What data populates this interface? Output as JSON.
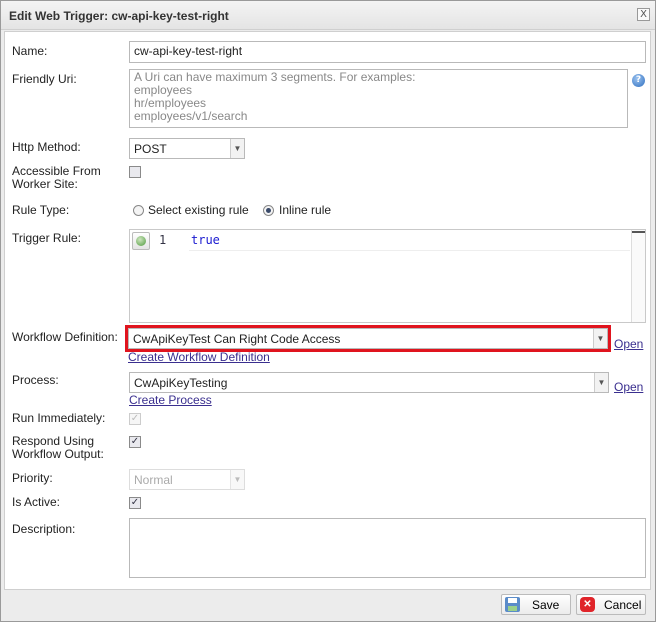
{
  "dialog": {
    "title": "Edit Web Trigger: cw-api-key-test-right",
    "close_label": "X"
  },
  "fields": {
    "name": {
      "label": "Name:",
      "value": "cw-api-key-test-right"
    },
    "friendly_uri": {
      "label": "Friendly Uri:",
      "placeholder_lines": [
        "A Uri can have maximum 3 segments. For examples:",
        "employees",
        "hr/employees",
        "employees/v1/search"
      ]
    },
    "http_method": {
      "label": "Http Method:",
      "value": "POST"
    },
    "accessible": {
      "label_lines": [
        "Accessible From",
        "Worker Site:"
      ],
      "checked": false
    },
    "rule_type": {
      "label": "Rule Type:",
      "options": [
        "Select existing rule",
        "Inline rule"
      ],
      "selected": "Inline rule"
    },
    "trigger_rule": {
      "label": "Trigger Rule:",
      "line_number": "1",
      "code": "true"
    },
    "workflow_definition": {
      "label": "Workflow Definition:",
      "value": "CwApiKeyTest Can Right Code Access",
      "open_link": "Open",
      "create_link": "Create Workflow Definition",
      "highlight_color": "#e0141e"
    },
    "process": {
      "label": "Process:",
      "value": "CwApiKeyTesting",
      "open_link": "Open",
      "create_link": "Create Process"
    },
    "run_immediately": {
      "label": "Run Immediately:",
      "checked": true,
      "disabled": true
    },
    "respond_using": {
      "label_lines": [
        "Respond Using",
        "Workflow Output:"
      ],
      "checked": true
    },
    "priority": {
      "label": "Priority:",
      "value": "Normal",
      "disabled": true
    },
    "is_active": {
      "label": "Is Active:",
      "checked": true
    },
    "description": {
      "label": "Description:",
      "value": ""
    }
  },
  "footer": {
    "save_label": "Save",
    "cancel_label": "Cancel"
  }
}
